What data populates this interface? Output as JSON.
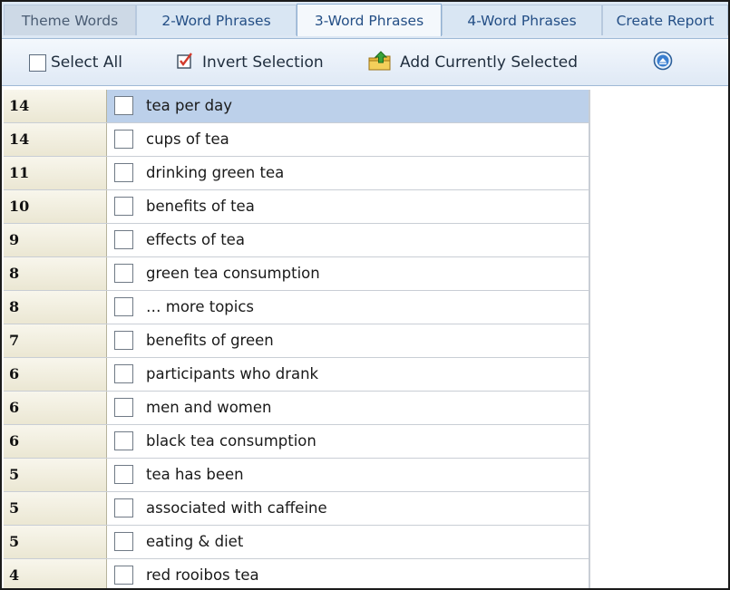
{
  "tabs": [
    "Theme Words",
    "2-Word Phrases",
    "3-Word Phrases",
    "4-Word Phrases",
    "Create Report"
  ],
  "active_tab": "3-Word Phrases",
  "toolbar": {
    "select_all": "Select All",
    "invert_selection": "Invert Selection",
    "add_currently_selected": "Add Currently Selected"
  },
  "rows": [
    {
      "count": "14",
      "phrase": "tea per day",
      "selected": true
    },
    {
      "count": "14",
      "phrase": "cups of tea"
    },
    {
      "count": "11",
      "phrase": "drinking green tea"
    },
    {
      "count": "10",
      "phrase": "benefits of tea"
    },
    {
      "count": "9",
      "phrase": "effects of tea"
    },
    {
      "count": "8",
      "phrase": "green tea consumption"
    },
    {
      "count": "8",
      "phrase": "… more topics"
    },
    {
      "count": "7",
      "phrase": "benefits of green"
    },
    {
      "count": "6",
      "phrase": "participants who drank"
    },
    {
      "count": "6",
      "phrase": "men and women"
    },
    {
      "count": "6",
      "phrase": "black tea consumption"
    },
    {
      "count": "5",
      "phrase": "tea has been"
    },
    {
      "count": "5",
      "phrase": "associated with caffeine"
    },
    {
      "count": "5",
      "phrase": "eating & diet"
    },
    {
      "count": "4",
      "phrase": "red rooibos tea"
    }
  ],
  "colors": {
    "accent": "#244f86",
    "selected_row": "#bcd0ea",
    "count_cell": "#ebe7d3"
  },
  "icons": [
    "invert-selection-icon",
    "add-folder-icon",
    "collapse-up-icon"
  ]
}
